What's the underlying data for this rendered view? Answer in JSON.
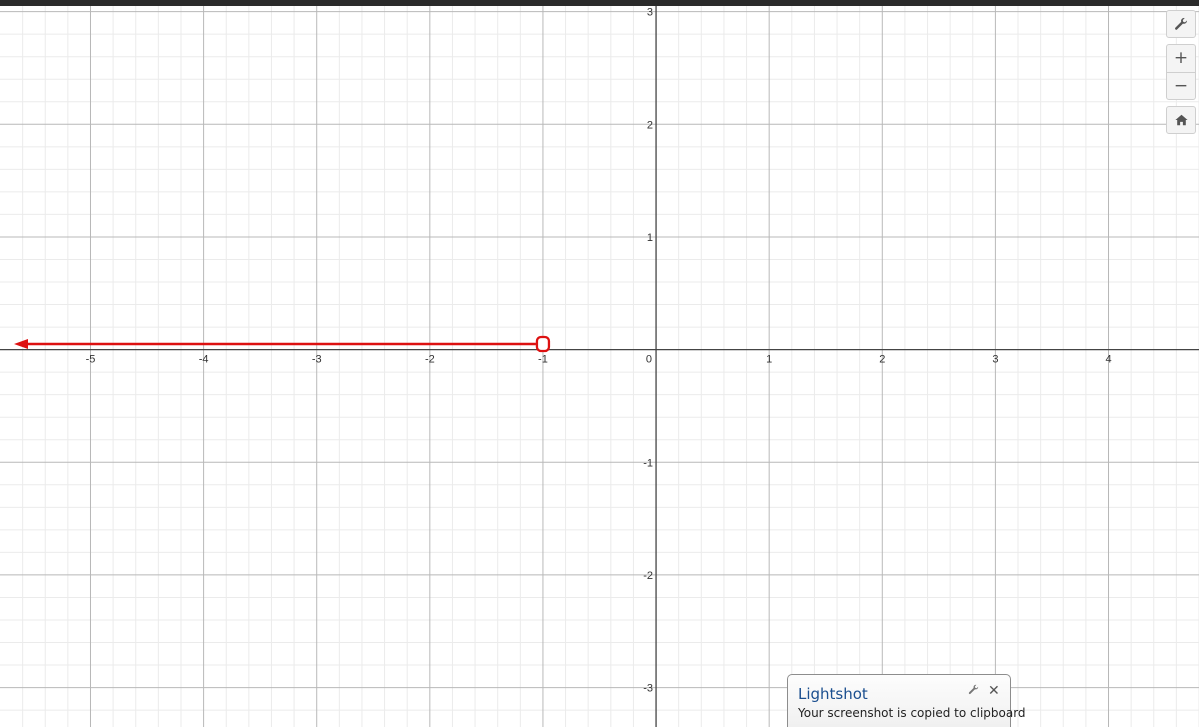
{
  "graph": {
    "x_tick_labels": [
      "-5",
      "-4",
      "-3",
      "-2",
      "-1",
      "0",
      "1",
      "2",
      "3",
      "4"
    ],
    "y_tick_labels": [
      "3",
      "2",
      "1",
      "-1",
      "-2",
      "-3"
    ],
    "x_range": [
      -5.8,
      4.8
    ],
    "y_range": [
      -3.35,
      3.05
    ],
    "major_gridline_step": 1,
    "minor_gridline_step": 0.2,
    "grid_color": "#cccccc",
    "axis_color": "#444444",
    "ray": {
      "color": "#dd1111",
      "endpoint": {
        "x": -1,
        "y": 0.05,
        "style": "open"
      },
      "direction": "left"
    }
  },
  "toolbar": {
    "settings_icon": "wrench-icon",
    "zoom_in_glyph": "+",
    "zoom_out_glyph": "−",
    "home_icon": "home-icon"
  },
  "toast": {
    "title": "Lightshot",
    "message": "Your screenshot is copied to clipboard",
    "settings_icon": "wrench-icon",
    "close_glyph": "✕"
  }
}
